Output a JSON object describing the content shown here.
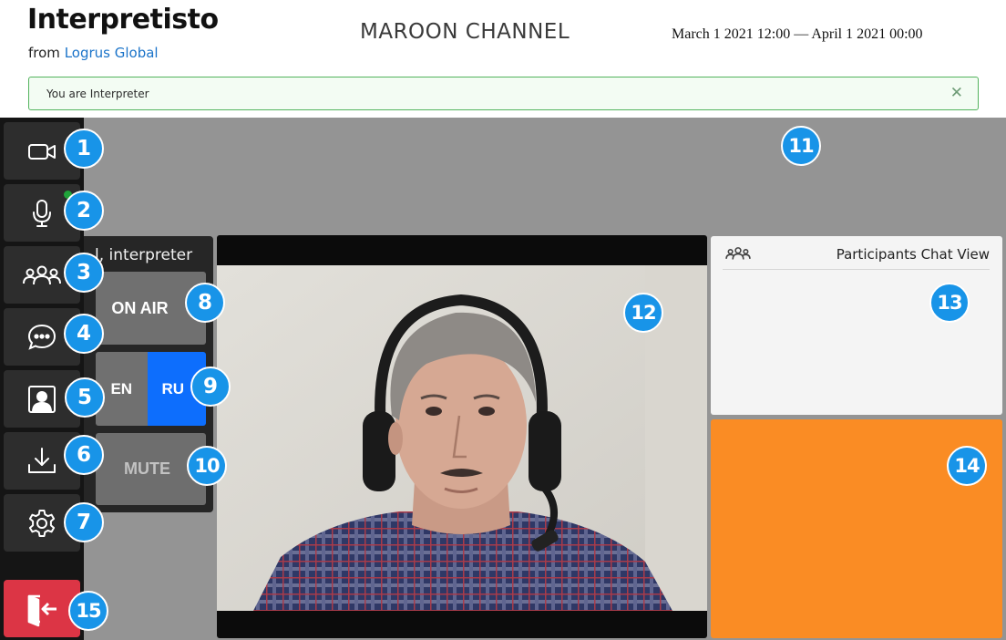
{
  "header": {
    "app_title": "Interpretisto",
    "from_prefix": "from",
    "from_link": "Logrus Global",
    "channel_name": "MAROON CHANNEL",
    "date_range": "March 1 2021 12:00 — April 1 2021 00:00"
  },
  "alert": {
    "text": "You are Interpreter",
    "close_glyph": "✕"
  },
  "sidebar": {
    "items": [
      {
        "name": "camera",
        "icon": "video-camera-icon"
      },
      {
        "name": "microphone",
        "icon": "microphone-icon",
        "status": "active"
      },
      {
        "name": "participants",
        "icon": "participants-icon"
      },
      {
        "name": "chat",
        "icon": "chat-bubble-icon"
      },
      {
        "name": "profile",
        "icon": "user-portrait-icon"
      },
      {
        "name": "download",
        "icon": "download-icon"
      },
      {
        "name": "settings",
        "icon": "gear-icon"
      }
    ],
    "exit_icon": "exit-door-icon"
  },
  "interpreter_panel": {
    "label": "l, interpreter",
    "on_air": "ON AIR",
    "languages": [
      "EN",
      "RU"
    ],
    "active_language": "RU",
    "mute": "MUTE"
  },
  "chat": {
    "title": "Participants Chat View",
    "icon": "participants-icon"
  },
  "markers": [
    "1",
    "2",
    "3",
    "4",
    "5",
    "6",
    "7",
    "8",
    "9",
    "10",
    "11",
    "12",
    "13",
    "14",
    "15"
  ],
  "colors": {
    "marker": "#1894e8",
    "active_language": "#0d6efd",
    "exit_button": "#dc3545",
    "orange_panel": "#fa8c24",
    "alert_border": "#52b35d"
  }
}
